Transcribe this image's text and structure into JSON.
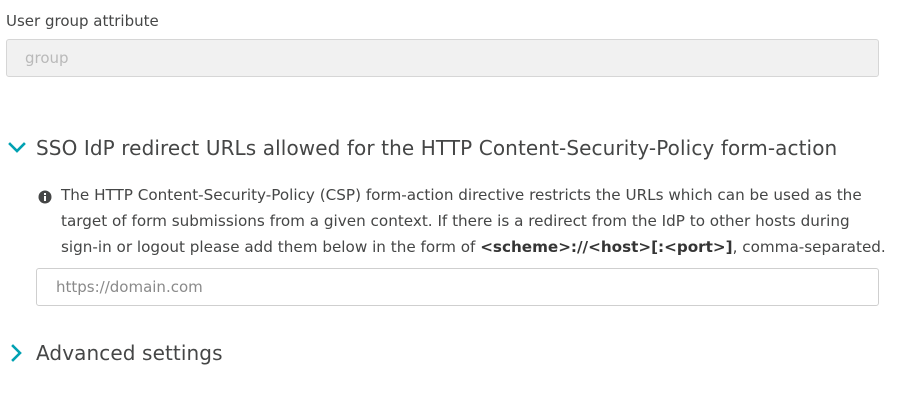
{
  "user_group": {
    "label": "User group attribute",
    "value": "",
    "placeholder": "group"
  },
  "sso_section": {
    "title": "SSO IdP redirect URLs allowed for the HTTP Content-Security-Policy form-action",
    "expanded": true,
    "info_line1": "The HTTP Content-Security-Policy (CSP) form-action directive restricts the URLs which can be used as the",
    "info_line2": "target of form submissions from a given context. If there is a redirect from the IdP to other hosts during",
    "info_line3_prefix": "sign-in or logout please add them below in the form of ",
    "info_line3_code": "<scheme>://<host>[:<port>]",
    "info_line3_suffix": ", comma-separated.",
    "url_input": {
      "value": "",
      "placeholder": "https://domain.com"
    }
  },
  "advanced_section": {
    "title": "Advanced settings",
    "expanded": false
  },
  "colors": {
    "accent": "#00a1b2",
    "text": "#454646"
  },
  "icons": {
    "expanded_chevron": "chevron-down-icon",
    "collapsed_chevron": "chevron-right-icon",
    "info": "info-icon"
  }
}
